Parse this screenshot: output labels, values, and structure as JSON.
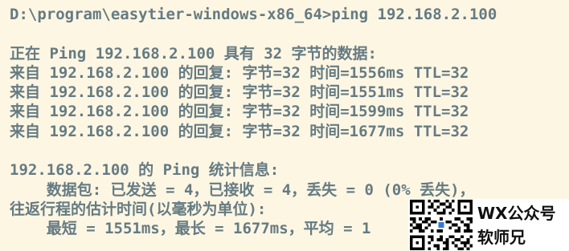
{
  "terminal": {
    "lines": [
      "D:\\program\\easytier-windows-x86_64>ping 192.168.2.100",
      "",
      "正在 Ping 192.168.2.100 具有 32 字节的数据:",
      "来自 192.168.2.100 的回复: 字节=32 时间=1556ms TTL=32",
      "来自 192.168.2.100 的回复: 字节=32 时间=1551ms TTL=32",
      "来自 192.168.2.100 的回复: 字节=32 时间=1599ms TTL=32",
      "来自 192.168.2.100 的回复: 字节=32 时间=1677ms TTL=32",
      "",
      "192.168.2.100 的 Ping 统计信息:",
      "    数据包: 已发送 = 4，已接收 = 4，丢失 = 0 (0% 丢失)，",
      "往返行程的估计时间(以毫秒为单位):",
      "    最短 = 1551ms，最长 = 1677ms，平均 = 1"
    ]
  },
  "watermark": {
    "line1": "WX公众号",
    "line2": "软师兄"
  },
  "colors": {
    "background": "#fdf6e3",
    "text": "#657b83"
  }
}
